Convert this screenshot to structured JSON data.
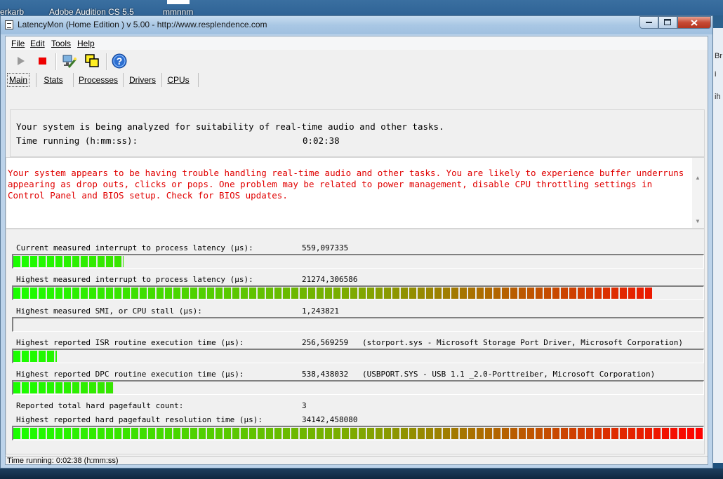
{
  "desktop": {
    "label_left": "erkarb",
    "label_audition": "Adobe Audition CS 5.5",
    "label_right": "mmnnm",
    "strip_letter_1": "Br",
    "strip_letter_2": "i",
    "strip_letter_3": "ih"
  },
  "window": {
    "title": "LatencyMon  (Home Edition )  v 5.00 - http://www.resplendence.com"
  },
  "menu": [
    "File",
    "Edit",
    "Tools",
    "Help"
  ],
  "tabs": [
    "Main",
    "Stats",
    "Processes",
    "Drivers",
    "CPUs"
  ],
  "status_panel": {
    "line1": "Your system is being analyzed for suitability of real-time audio and other tasks.",
    "time_label": "Time running (h:mm:ss):",
    "time_value": "0:02:38"
  },
  "warning": "Your system appears to be having trouble handling real-time audio and other tasks. You are likely to experience buffer underruns appearing as drop outs, clicks or pops. One problem may be related to power management, disable CPU throttling settings in Control Panel and BIOS setup. Check for BIOS updates.",
  "metrics": [
    {
      "label": "Current measured interrupt to process latency (µs):",
      "value": "559,097335",
      "info": "",
      "bar_fraction": 0.16
    },
    {
      "label": "Highest measured interrupt to process latency (µs):",
      "value": "21274,306586",
      "info": "",
      "bar_fraction": 0.926
    },
    {
      "label": "Highest measured SMI, or CPU stall (µs):",
      "value": "1,243821",
      "info": "",
      "bar_fraction": 0
    },
    {
      "label": "Highest reported ISR routine execution time (µs):",
      "value": "256,569259",
      "info": "(storport.sys - Microsoft Storage Port Driver, Microsoft Corporation)",
      "bar_fraction": 0.063
    },
    {
      "label": "Highest reported DPC routine execution time (µs):",
      "value": "538,438032",
      "info": "(USBPORT.SYS - USB 1.1 _2.0-Porttreiber, Microsoft Corporation)",
      "bar_fraction": 0.145
    }
  ],
  "pagefault": {
    "count_label": "Reported total hard pagefault count:",
    "count_value": "3",
    "time_label": "Highest reported hard pagefault resolution time (µs):",
    "time_value": "34142,458080",
    "bar_fraction": 1.0
  },
  "statusbar": "Time running: 0:02:38  (h:mm:ss)",
  "colors": {
    "bar_low": "#19ff00",
    "bar_mid": "#7fa800",
    "bar_high": "#ff0000",
    "warning": "#e00000"
  }
}
